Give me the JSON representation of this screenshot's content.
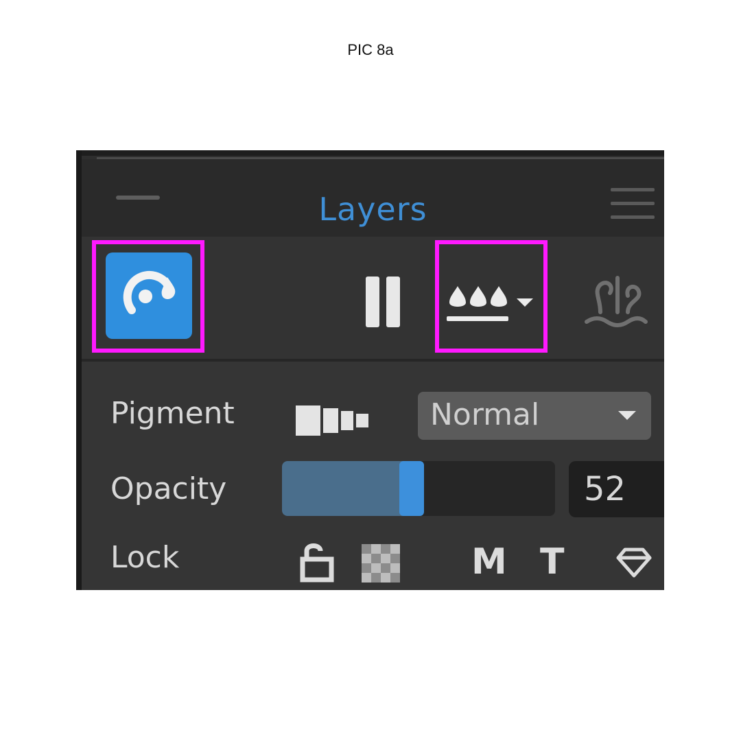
{
  "caption": "PIC 8a",
  "panel": {
    "title": "Layers"
  },
  "toolbar": {
    "wet_mode_icon": "eye-droplet-icon",
    "pause_icon": "pause-icon",
    "wetness_icon": "water-drops-dropdown-icon",
    "water_icon": "water-plants-icon"
  },
  "properties": {
    "pigment_label": "Pigment",
    "pigment_icon": "pigment-tube-icon",
    "blend_mode": "Normal",
    "opacity_label": "Opacity",
    "opacity_value": "52",
    "opacity_fraction": 0.52,
    "lock_label": "Lock",
    "lock_items": [
      {
        "icon": "unlock-icon",
        "text": ""
      },
      {
        "icon": "transparency-checker-icon",
        "text": ""
      },
      {
        "icon": "mask-icon",
        "text": "M"
      },
      {
        "icon": "text-icon",
        "text": "T"
      },
      {
        "icon": "diamond-icon",
        "text": ""
      }
    ]
  },
  "colors": {
    "accent": "#3f8fd6",
    "highlight": "#ff19ff",
    "panel_bg": "#2e2e2e"
  }
}
